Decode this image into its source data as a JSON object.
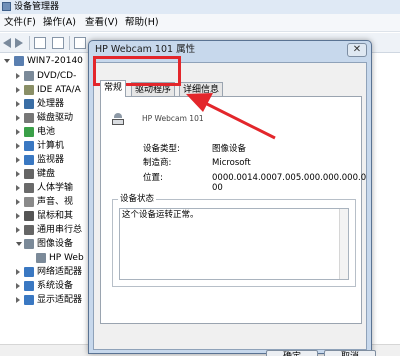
{
  "window": {
    "title": "设备管理器"
  },
  "menu": {
    "items": [
      "文件(F)",
      "操作(A)",
      "查看(V)",
      "帮助(H)"
    ]
  },
  "tree": {
    "root": "WIN7-20140",
    "items": [
      {
        "label": "DVD/CD-",
        "icon_color": "#7b8a99"
      },
      {
        "label": "IDE ATA/A",
        "icon_color": "#8a8f66"
      },
      {
        "label": "处理器",
        "icon_color": "#3a6ea5"
      },
      {
        "label": "磁盘驱动",
        "icon_color": "#777777"
      },
      {
        "label": "电池",
        "icon_color": "#3aa048"
      },
      {
        "label": "计算机",
        "icon_color": "#3a78c2"
      },
      {
        "label": "监视器",
        "icon_color": "#3a78c2"
      },
      {
        "label": "键盘",
        "icon_color": "#666666"
      },
      {
        "label": "人体学输",
        "icon_color": "#6a6a6a"
      },
      {
        "label": "声音、视",
        "icon_color": "#8a8a8a"
      },
      {
        "label": "鼠标和其",
        "icon_color": "#555555"
      },
      {
        "label": "通用串行总",
        "icon_color": "#666666"
      },
      {
        "label": "图像设备",
        "icon_color": "#7b8a99"
      },
      {
        "label": "HP Web",
        "icon_color": "#7b8a99"
      },
      {
        "label": "网络适配器",
        "icon_color": "#3a78c2"
      },
      {
        "label": "系统设备",
        "icon_color": "#3a78c2"
      },
      {
        "label": "显示适配器",
        "icon_color": "#3a78c2"
      }
    ]
  },
  "dialog": {
    "title": "HP Webcam 101 属性",
    "close_glyph": "✕",
    "tabs": [
      "常规",
      "驱动程序",
      "详细信息"
    ],
    "device_name": "HP Webcam 101",
    "properties": [
      {
        "label": "设备类型:",
        "value": "图像设备"
      },
      {
        "label": "制造商:",
        "value": "Microsoft"
      },
      {
        "label": "位置:",
        "value": "0000.0014.0007.005.000.000.000.0"
      },
      {
        "label": "",
        "value": "00"
      }
    ],
    "status_group_label": "设备状态",
    "status_text": "这个设备运转正常。",
    "buttons": {
      "ok": "确定",
      "cancel": "取消"
    }
  },
  "annotation_color": "#e3262b"
}
